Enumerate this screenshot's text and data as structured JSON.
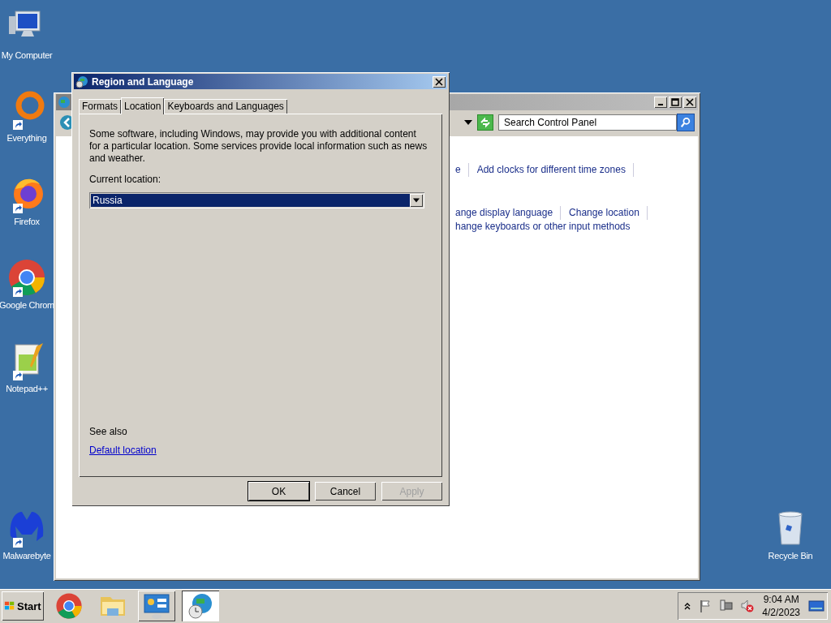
{
  "desktop_icons": [
    {
      "label": "My Computer",
      "kind": "computer",
      "shortcut": false
    },
    {
      "label": "Everything",
      "kind": "everything",
      "shortcut": true
    },
    {
      "label": "Firefox",
      "kind": "firefox",
      "shortcut": true
    },
    {
      "label": "Google Chrom",
      "kind": "chrome",
      "shortcut": true
    },
    {
      "label": "Notepad++",
      "kind": "notepad",
      "shortcut": true
    },
    {
      "label": "Malwarebyte",
      "kind": "malwarebytes",
      "shortcut": true
    }
  ],
  "recycle_bin": {
    "label": "Recycle Bin"
  },
  "control_panel": {
    "search": {
      "placeholder": "Search Control Panel"
    },
    "link_rows": [
      [
        "e",
        "Add clocks for different time zones"
      ],
      [
        "ange display language",
        "Change location"
      ],
      [
        "hange keyboards or other input methods"
      ]
    ]
  },
  "dialog": {
    "title": "Region and Language",
    "tabs": [
      {
        "label": "Formats",
        "selected": false
      },
      {
        "label": "Location",
        "selected": true
      },
      {
        "label": "Keyboards and Languages",
        "selected": false
      }
    ],
    "description": "Some software, including Windows, may provide you with additional content for a particular location. Some services provide local information such as news and weather.",
    "location_label": "Current location:",
    "location_value": "Russia",
    "see_also": "See also",
    "default_location_link": "Default location",
    "buttons": [
      {
        "label": "OK",
        "disabled": false,
        "default": true
      },
      {
        "label": "Cancel",
        "disabled": false,
        "default": false
      },
      {
        "label": "Apply",
        "disabled": true,
        "default": false
      }
    ]
  },
  "taskbar": {
    "start": "Start",
    "items": [
      {
        "kind": "chrome",
        "selected": false
      },
      {
        "kind": "folder",
        "selected": false
      },
      {
        "kind": "control-panel",
        "selected": false
      },
      {
        "kind": "globe-clock",
        "selected": true
      }
    ],
    "time": "9:04 AM",
    "date": "4/2/2023"
  }
}
